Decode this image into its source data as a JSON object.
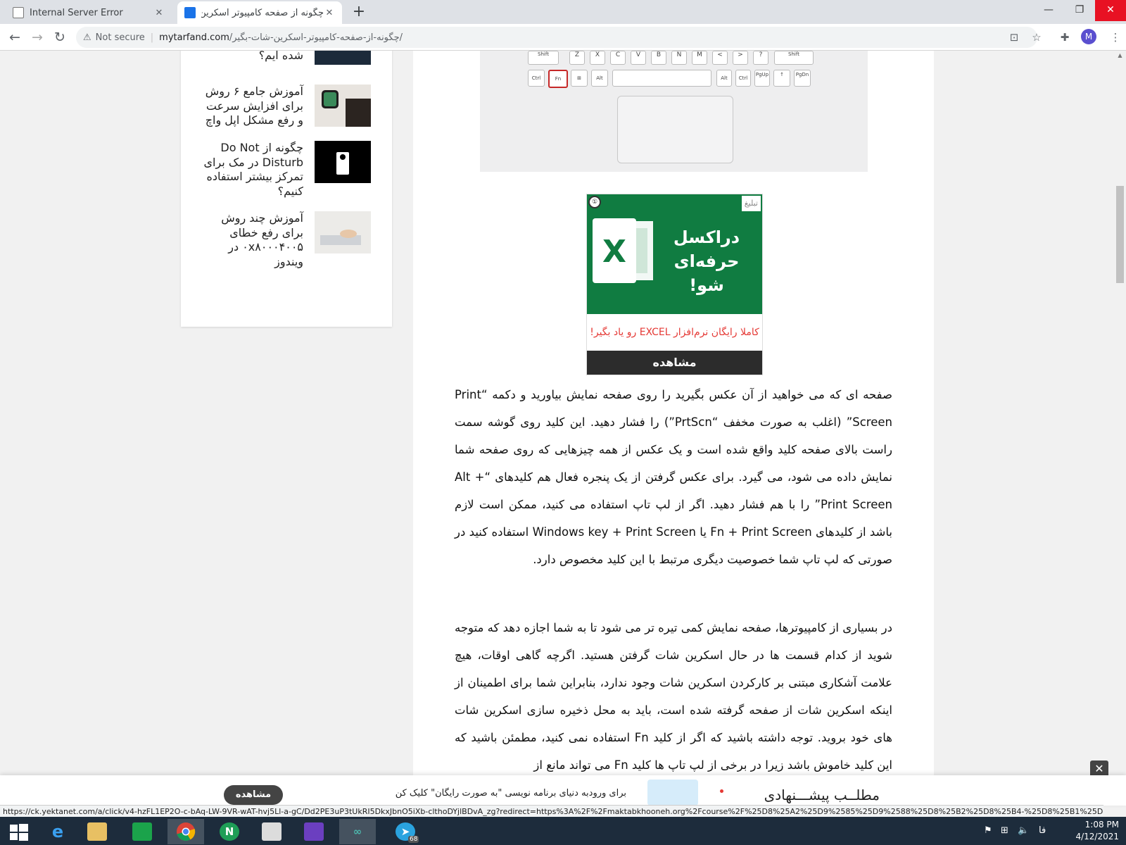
{
  "browser": {
    "tabs": [
      {
        "title": "Internal Server Error",
        "active": false
      },
      {
        "title": "چگونه از صفحه کامپیوتر اسکرین شا",
        "active": true
      }
    ],
    "new_tab": "+",
    "tab_close": "✕",
    "window_controls": {
      "minimize": "—",
      "restore": "❐",
      "close": "✕"
    },
    "nav": {
      "back": "←",
      "forward": "→",
      "reload": "↻"
    },
    "security_label": "Not secure",
    "url_domain": "mytarfand.com",
    "url_path": "/چگونه-از-صفحه-کامپیوتر-اسکرین-شات-بگیر/",
    "profile_initial": "M"
  },
  "sidebar": {
    "items": [
      {
        "title": "WhatsApp بلاک شده ایم؟",
        "thumb": "dark-photo"
      },
      {
        "title": "آموزش جامع ۶ روش برای افزایش سرعت و رفع مشکل اپل واچ",
        "thumb": "watch-photo"
      },
      {
        "title": "چگونه از Do Not Disturb در مک برای تمرکز بیشتر استفاده کنیم؟",
        "thumb": "do-not-disturb-sign"
      },
      {
        "title": "آموزش چند روش برای رفع خطای ۰x۸۰۰۰۴۰۰۵ در ویندوز",
        "thumb": "laptop-typing-photo"
      }
    ]
  },
  "keyboard": {
    "row1": [
      "Shift",
      "Z",
      "X",
      "C",
      "V",
      "B",
      "N",
      "M",
      "<",
      ">",
      "?",
      "Shift"
    ],
    "row2": [
      "Ctrl",
      "Fn",
      "⊞",
      "Alt",
      "",
      "Alt",
      "Ctrl",
      "PgUp",
      "↑",
      "PgDn"
    ],
    "highlighted_key": "Fn",
    "highlight_color": "#c62828"
  },
  "ad": {
    "tag": "تبلیغ",
    "badge": "①",
    "headline": "دراکسل حرفه‌ای شو!",
    "logo_letter": "X",
    "subtitle": "کاملا رایگان نرم‌افزار EXCEL رو یاد بگیر!",
    "cta": "مشاهده",
    "brand_color": "#107c41"
  },
  "article": {
    "paragraphs": [
      "صفحه ای که می خواهید از آن عکس بگیرید را روی صفحه نمایش بیاورید و دکمه “Print Screen” (اغلب به صورت مخفف “PrtScn”) را فشار دهید. این کلید روی گوشه سمت راست بالای صفحه کلید واقع شده است و یک عکس از همه چیزهایی که روی صفحه شما نمایش داده می شود، می گیرد. برای عکس گرفتن از یک پنجره فعال هم کلیدهای “Alt + Print Screen” را با هم فشار دهید. اگر از لپ تاپ استفاده می کنید، ممکن است لازم باشد از کلیدهای Fn + Print Screen یا Windows key + Print Screen استفاده کنید در صورتی که لپ تاپ شما خصوصیت دیگری مرتبط با این کلید مخصوص دارد.",
      "در بسیاری از کامپیوترها، صفحه نمایش کمی تیره تر می شود تا به شما اجازه دهد که متوجه شوید از کدام قسمت ها در حال اسکرین شات گرفتن هستید. اگرچه گاهی اوقات، هیچ علامت آشکاری مبتنی بر کارکردن اسکرین شات وجود ندارد، بنابراین شما برای اطمینان از اینکه اسکرین شات از صفحه گرفته شده است، باید به محل ذخیره سازی اسکرین شات های خود بروید. توجه داشته باشید که اگر از کلید Fn استفاده نمی کنید، مطمئن باشید که این کلید خاموش باشد زیرا در برخی از لپ تاپ ها کلید Fn می تواند مانع از"
    ]
  },
  "overlay_close": "✕",
  "promo": {
    "cta": "مشاهده",
    "text": "برای ورودبه دنیای برنامه نویسی \"به صورت رایگان\" کلیک کن",
    "heading": "مطلــب پیشـــنهادی"
  },
  "status_url": "https://ck.yektanet.com/a/click/v4-hzFL1EP2O-c-bAq-LW-9VR-wAT-hvj5Ll-a-gC/Dd2PE3uP3tUkRI5DkxJbnO5iXb-clthoDYjlBDvA_zg?redirect=https%3A%2F%2Fmaktabkhooneh.org%2Fcourse%2F%25D8%25A2%25D9%2585%25D9%2588%25D8%25B2%25D8%25B4-%25D8%25B1%25D8%25A7...",
  "taskbar": {
    "apps": [
      "windows-start",
      "internet-explorer",
      "file-explorer",
      "store",
      "chrome",
      "notepad-plus",
      "notes",
      "visual-studio",
      "arduino",
      "telegram"
    ],
    "telegram_badge": "68",
    "tray_lang": "فا",
    "time": "1:08 PM",
    "date": "4/12/2021"
  }
}
